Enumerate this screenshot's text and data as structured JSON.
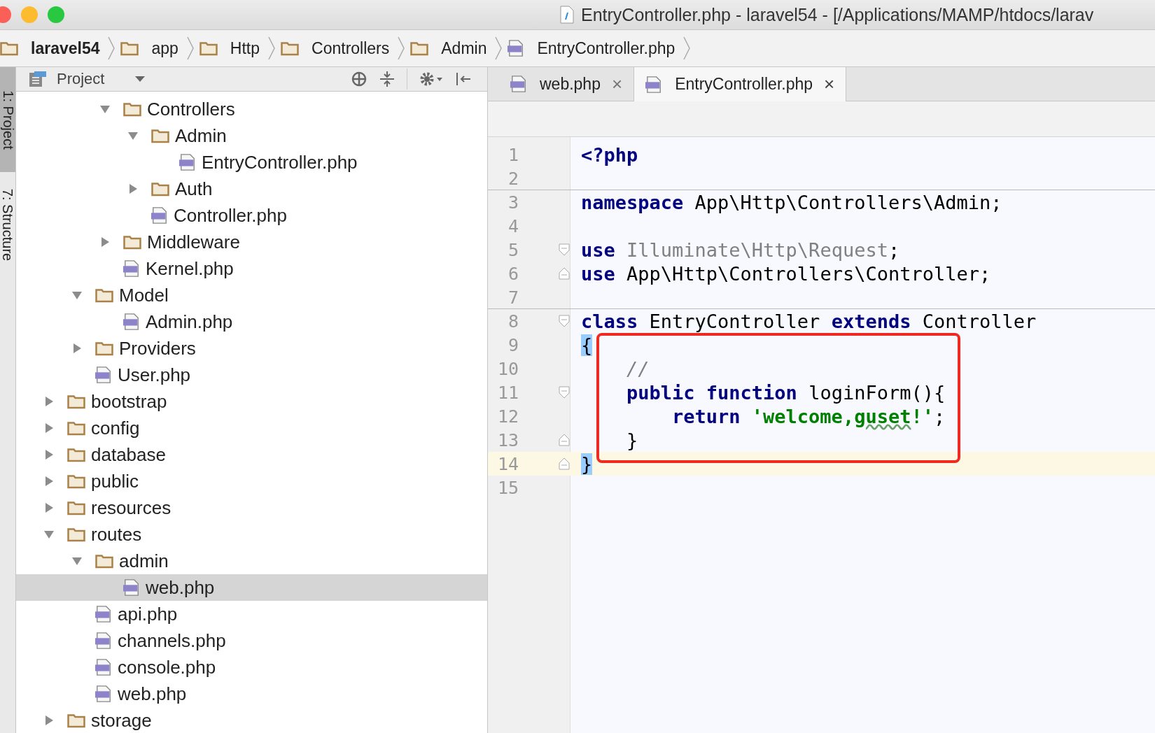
{
  "window": {
    "title": "EntryController.php - laravel54 - [/Applications/MAMP/htdocs/larav"
  },
  "breadcrumbs": [
    {
      "label": "laravel54",
      "kind": "folder",
      "bold": true
    },
    {
      "label": "app",
      "kind": "folder",
      "bold": false
    },
    {
      "label": "Http",
      "kind": "folder",
      "bold": false
    },
    {
      "label": "Controllers",
      "kind": "folder",
      "bold": false
    },
    {
      "label": "Admin",
      "kind": "folder",
      "bold": false
    },
    {
      "label": "EntryController.php",
      "kind": "php",
      "bold": false
    }
  ],
  "tool_strip": [
    {
      "label": "1: Project",
      "selected": true
    },
    {
      "label": "7: Structure",
      "selected": false
    }
  ],
  "project_panel": {
    "title": "Project",
    "tree": [
      {
        "children": [
          {
            "children": [
              {
                "label": "Controllers",
                "kind": "folder",
                "expanded": true,
                "selected": false,
                "children": [
                  {
                    "label": "Admin",
                    "kind": "folder",
                    "expanded": true,
                    "selected": false,
                    "children": [
                      {
                        "label": "EntryController.php",
                        "kind": "php",
                        "selected": false
                      }
                    ]
                  },
                  {
                    "label": "Auth",
                    "kind": "folder",
                    "expanded": false,
                    "selected": false
                  },
                  {
                    "label": "Controller.php",
                    "kind": "php",
                    "selected": false
                  }
                ]
              },
              {
                "label": "Middleware",
                "kind": "folder",
                "expanded": false,
                "selected": false
              },
              {
                "label": "Kernel.php",
                "kind": "php",
                "selected": false
              }
            ]
          },
          {
            "label": "Model",
            "kind": "folder",
            "expanded": true,
            "selected": false,
            "children": [
              {
                "label": "Admin.php",
                "kind": "php",
                "selected": false
              }
            ]
          },
          {
            "label": "Providers",
            "kind": "folder",
            "expanded": false,
            "selected": false
          },
          {
            "label": "User.php",
            "kind": "php",
            "selected": false
          }
        ]
      },
      {
        "label": "bootstrap",
        "kind": "folder",
        "expanded": false,
        "selected": false
      },
      {
        "label": "config",
        "kind": "folder",
        "expanded": false,
        "selected": false
      },
      {
        "label": "database",
        "kind": "folder",
        "expanded": false,
        "selected": false
      },
      {
        "label": "public",
        "kind": "folder",
        "expanded": false,
        "selected": false
      },
      {
        "label": "resources",
        "kind": "folder",
        "expanded": false,
        "selected": false
      },
      {
        "label": "routes",
        "kind": "folder",
        "expanded": true,
        "selected": false,
        "children": [
          {
            "label": "admin",
            "kind": "folder",
            "expanded": true,
            "selected": false,
            "children": [
              {
                "label": "web.php",
                "kind": "php",
                "selected": true
              }
            ]
          },
          {
            "label": "api.php",
            "kind": "php",
            "selected": false
          },
          {
            "label": "channels.php",
            "kind": "php",
            "selected": false
          },
          {
            "label": "console.php",
            "kind": "php",
            "selected": false
          },
          {
            "label": "web.php",
            "kind": "php",
            "selected": false
          }
        ]
      },
      {
        "label": "storage",
        "kind": "folder",
        "expanded": false,
        "selected": false
      }
    ]
  },
  "editor": {
    "tabs": [
      {
        "label": "web.php",
        "close": "×",
        "selected": false
      },
      {
        "label": "EntryController.php",
        "close": "×",
        "selected": true
      }
    ],
    "lines": [
      {
        "number": "1",
        "current": false,
        "separator": false,
        "fold_start": false,
        "fold_end": false,
        "tokens": [
          {
            "kind": "keyword",
            "text": "<?php"
          }
        ]
      },
      {
        "number": "2",
        "current": false,
        "separator": false,
        "fold_start": false,
        "fold_end": false
      },
      {
        "number": "3",
        "current": false,
        "separator": true,
        "fold_start": false,
        "fold_end": false,
        "tokens": [
          {
            "kind": "keyword",
            "text": "namespace"
          },
          {
            "kind": "plain",
            "text": " App\\Http\\Controllers\\Admin;"
          }
        ]
      },
      {
        "number": "4",
        "current": false,
        "separator": false,
        "fold_start": false,
        "fold_end": false
      },
      {
        "number": "5",
        "current": false,
        "separator": false,
        "fold_start": true,
        "fold_end": false,
        "tokens": [
          {
            "kind": "keyword",
            "text": "use"
          },
          {
            "kind": "unused",
            "text": " Illuminate\\Http\\Request"
          },
          {
            "kind": "plain",
            "text": ";"
          }
        ]
      },
      {
        "number": "6",
        "current": false,
        "separator": false,
        "fold_start": false,
        "fold_end": true,
        "tokens": [
          {
            "kind": "keyword",
            "text": "use"
          },
          {
            "kind": "plain",
            "text": " App\\Http\\Controllers\\Controller;"
          }
        ]
      },
      {
        "number": "7",
        "current": false,
        "separator": false,
        "fold_start": false,
        "fold_end": false
      },
      {
        "number": "8",
        "current": false,
        "separator": true,
        "fold_start": true,
        "fold_end": false,
        "tokens": [
          {
            "kind": "keyword",
            "text": "class"
          },
          {
            "kind": "plain",
            "text": " EntryController "
          },
          {
            "kind": "keyword",
            "text": "extends"
          },
          {
            "kind": "plain",
            "text": " Controller"
          }
        ]
      },
      {
        "number": "9",
        "current": false,
        "separator": false,
        "fold_start": false,
        "fold_end": false,
        "tokens": [
          {
            "kind": "brace-match",
            "text": "{"
          }
        ]
      },
      {
        "number": "10",
        "current": false,
        "separator": false,
        "fold_start": false,
        "fold_end": false,
        "tokens": [
          {
            "kind": "comment",
            "text": "    //"
          }
        ]
      },
      {
        "number": "11",
        "current": false,
        "separator": false,
        "fold_start": true,
        "fold_end": false,
        "tokens": [
          {
            "kind": "keyword",
            "text": "    public"
          },
          {
            "kind": "keyword",
            "text": " function"
          },
          {
            "kind": "plain",
            "text": " loginForm(){"
          }
        ]
      },
      {
        "number": "12",
        "current": false,
        "separator": false,
        "fold_start": false,
        "fold_end": false,
        "tokens": [
          {
            "kind": "keyword",
            "text": "        return"
          },
          {
            "kind": "string",
            "text": " 'welcome,"
          },
          {
            "kind": "typo",
            "text": "guset"
          },
          {
            "kind": "string",
            "text": "!'"
          },
          {
            "kind": "plain",
            "text": ";"
          }
        ]
      },
      {
        "number": "13",
        "current": false,
        "separator": false,
        "fold_start": false,
        "fold_end": true,
        "tokens": [
          {
            "kind": "plain",
            "text": "    }"
          }
        ]
      },
      {
        "number": "14",
        "current": true,
        "separator": false,
        "fold_start": false,
        "fold_end": true,
        "tokens": [
          {
            "kind": "brace-match",
            "text": "}"
          }
        ]
      },
      {
        "number": "15",
        "current": false,
        "separator": false,
        "fold_start": false,
        "fold_end": false
      }
    ]
  }
}
